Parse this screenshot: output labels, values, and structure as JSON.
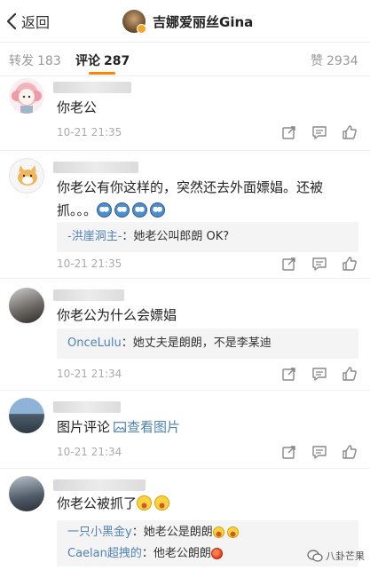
{
  "header": {
    "back_label": "返回",
    "title": "吉娜爱丽丝Gina"
  },
  "tabs": [
    {
      "label": "转发",
      "count": "183"
    },
    {
      "label": "评论",
      "count": "287"
    },
    {
      "label": "赞",
      "count": "2934"
    }
  ],
  "comments": [
    {
      "text": "你老公",
      "time": "10-21 21:35"
    },
    {
      "text_line1": "你老公有你这样的，突然还去外面嫖娼。还被",
      "text_line2": "抓。。。",
      "emojis": [
        "cry-emoji",
        "cry-emoji",
        "cry-emoji",
        "cry-emoji"
      ],
      "reply": {
        "who": "-洪崖洞主-",
        "sep": "：",
        "text": "她老公叫郎朗 OK?"
      },
      "time": "10-21 21:35"
    },
    {
      "text": "你老公为什么会嫖娼",
      "reply": {
        "who": "OnceLulu",
        "sep": "：",
        "text": "她丈夫是朗朗，不是李某迪"
      },
      "time": "10-21 21:34"
    },
    {
      "text": "图片评论",
      "link_label": "查看图片",
      "time": "10-21 21:34"
    },
    {
      "text": "你老公被抓了",
      "emojis": [
        "laugh-cry-emoji",
        "laugh-cry-emoji"
      ],
      "replies": [
        {
          "who": "一只小黑金y",
          "sep": "：",
          "text": "她老公是朗朗"
        },
        {
          "who": "Caelan超拽的",
          "sep": "：",
          "text": "他老公朗朗"
        }
      ]
    }
  ],
  "watermark": "八卦芒果",
  "colors": {
    "accent": "#ff8200",
    "link": "#4e82b8",
    "muted": "#aaaaaa"
  }
}
